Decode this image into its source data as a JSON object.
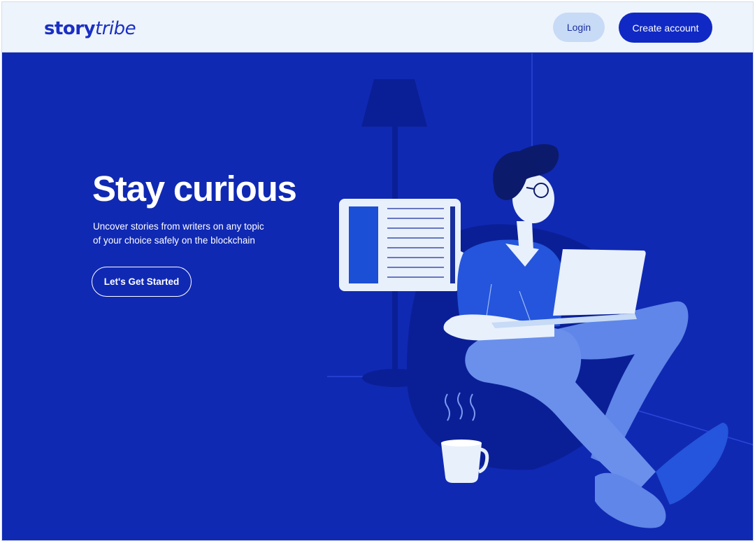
{
  "header": {
    "logo_bold": "story",
    "logo_italic": "tribe",
    "login_label": "Login",
    "create_label": "Create account"
  },
  "hero": {
    "title": "Stay curious",
    "subtitle_line1": "Uncover stories from writers on any topic",
    "subtitle_line2": "of your choice safely on the blockchain",
    "cta_label": "Let's Get Started"
  },
  "colors": {
    "brand": "#1a2fc4",
    "hero_bg": "#1029b3",
    "header_bg": "#eef4fc",
    "login_bg": "#c7daf6"
  },
  "illustration": {
    "icons": [
      "floor-lamp-icon",
      "reader-card-icon",
      "person-with-laptop-illustration",
      "coffee-mug-icon",
      "beanbag-chair-icon"
    ]
  }
}
